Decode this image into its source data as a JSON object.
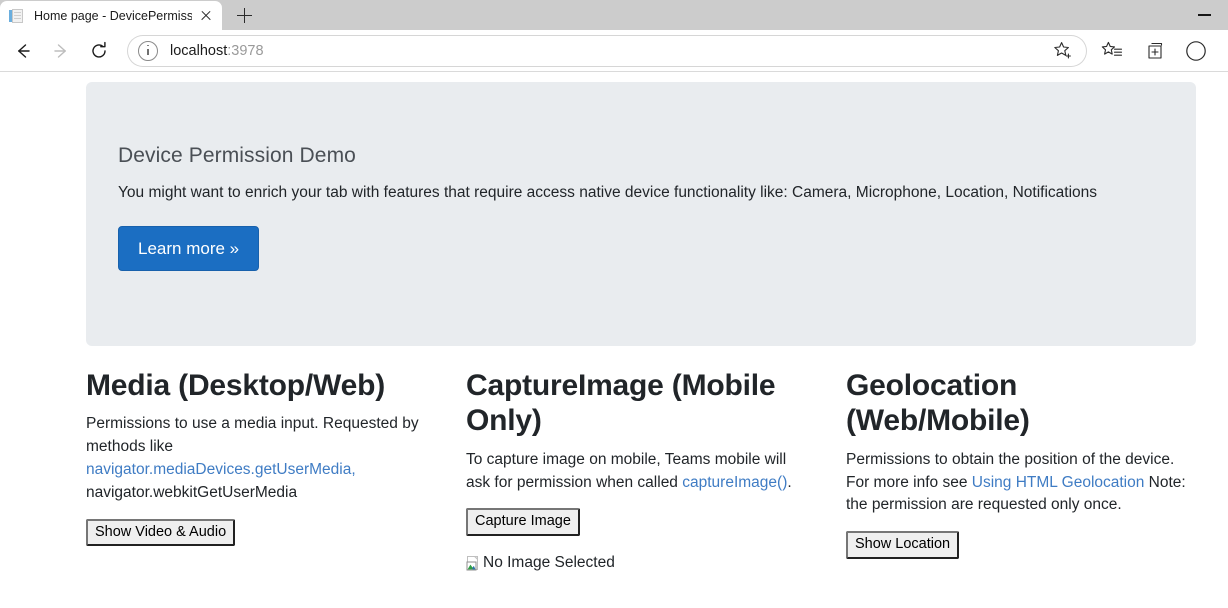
{
  "browser": {
    "tab": {
      "title": "Home page - DevicePermissions",
      "favicon": "document-favicon",
      "close_label": "×"
    },
    "newtab_label": "+",
    "window_controls": {
      "minimize": "—"
    },
    "toolbar": {
      "back": "back-arrow",
      "forward": "forward-arrow",
      "refresh": "refresh-arrow",
      "site_info": "info-icon",
      "url_host": "localhost",
      "url_port": ":3978",
      "favorite": "star-add-icon",
      "favorites_list": "star-list-icon",
      "collections": "collections-icon"
    }
  },
  "page": {
    "jumbotron": {
      "title": "Device Permission Demo",
      "lead": "You might want to enrich your tab with features that require access native device functionality like: Camera, Microphone, Location, Notifications",
      "cta_label": "Learn more »",
      "background": "#e9ecef",
      "cta_color": "#1b6ec2"
    },
    "columns": [
      {
        "heading": "Media (Desktop/Web)",
        "text_before": "Permissions to use a media input. Requested by methods like ",
        "link_text": "navigator.mediaDevices.getUserMedia,",
        "text_after": " navigator.webkitGetUserMedia",
        "button_label": "Show Video & Audio"
      },
      {
        "heading": "CaptureImage (Mobile Only)",
        "text_before": "To capture image on mobile, Teams mobile will ask for permission when called ",
        "link_text": "captureImage()",
        "text_after": ".",
        "button_label": "Capture Image",
        "image_alt": "No Image Selected"
      },
      {
        "heading": "Geolocation (Web/Mobile)",
        "text_before": "Permissions to obtain the position of the device. For more info see ",
        "link_text": "Using HTML Geolocation",
        "text_after": " Note: the permission are requested only once.",
        "button_label": "Show Location"
      }
    ],
    "link_color": "#3f7cc4"
  }
}
